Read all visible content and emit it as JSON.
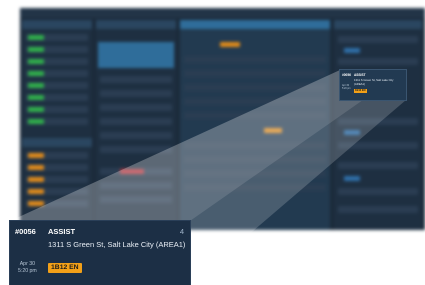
{
  "incident": {
    "id": "#0056",
    "type": "ASSIST",
    "count": "4",
    "address": "1311 S Green St, Salt Lake City (AREA1)",
    "date": "Apr 30",
    "time": "5:20 pm",
    "unit_badge": "1B12 EN",
    "badge_color": "#f2a018"
  },
  "colors": {
    "app_background": "#1b2a3a",
    "selected_row": "#2f6d9a",
    "status_green": "#2fae4a",
    "status_orange": "#e08a1a",
    "status_red": "#b8323a"
  }
}
